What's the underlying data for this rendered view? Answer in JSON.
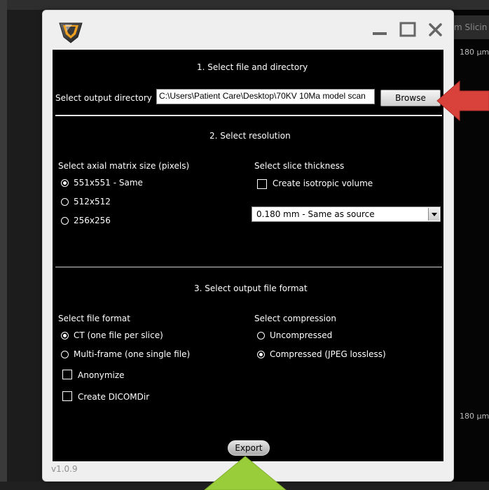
{
  "background": {
    "header_text": "m Slicin",
    "scale_top": "180 µm",
    "scale_bottom": "180 µm"
  },
  "window": {
    "logo_icon": "app-logo-icon",
    "controls": [
      "minimize-icon",
      "maximize-icon",
      "close-icon"
    ],
    "version": "v1.0.9"
  },
  "section1": {
    "title": "1. Select file and directory",
    "output_dir_label": "Select output directory",
    "output_dir_value": "C:\\Users\\Patient Care\\Desktop\\70KV 10Ma model scan",
    "browse_label": "Browse"
  },
  "section2": {
    "title": "2. Select resolution",
    "matrix_label": "Select axial matrix size (pixels)",
    "matrix_options": [
      {
        "label": "551x551 - Same",
        "selected": true
      },
      {
        "label": "512x512",
        "selected": false
      },
      {
        "label": "256x256",
        "selected": false
      }
    ],
    "thickness_label": "Select slice thickness",
    "isotropic_label": "Create isotropic volume",
    "isotropic_checked": false,
    "thickness_value": "0.180 mm - Same as source"
  },
  "section3": {
    "title": "3. Select output file format",
    "format_label": "Select file format",
    "format_options": [
      {
        "label": "CT (one file per slice)",
        "selected": true
      },
      {
        "label": "Multi-frame (one single file)",
        "selected": false
      }
    ],
    "anonymize_label": "Anonymize",
    "dicomdir_label": "Create DICOMDir",
    "compression_label": "Select compression",
    "compression_options": [
      {
        "label": "Uncompressed",
        "selected": false
      },
      {
        "label": "Compressed (JPEG lossless)",
        "selected": true
      }
    ]
  },
  "export_label": "Export",
  "colors": {
    "annotation_red": "#d9423a",
    "annotation_green": "#9acd3a",
    "panel_bg": "#000000",
    "dialog_bg": "#efefef"
  }
}
